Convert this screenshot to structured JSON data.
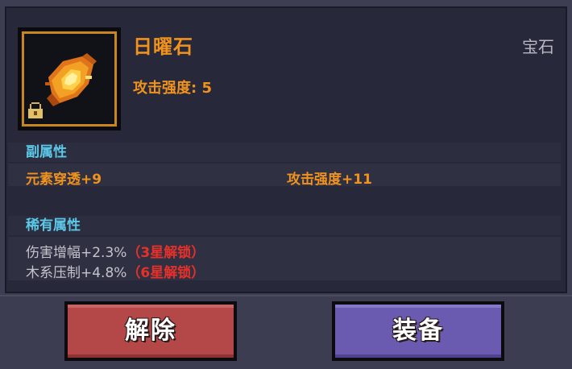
{
  "item": {
    "name": "日曜石",
    "type": "宝石",
    "main_stat": "攻击强度: 5",
    "icon": "sun-stone-gem-icon",
    "locked_icon": "lock-icon",
    "frame_color": "#c8871e"
  },
  "sub_attributes": {
    "header": "副属性",
    "stats": [
      "元素穿透+9",
      "攻击强度+11"
    ]
  },
  "rare_attributes": {
    "header": "稀有属性",
    "lines": [
      {
        "text": "伤害增幅+2.3%",
        "lock_text": "（3星解锁）"
      },
      {
        "text": "木系压制+4.8%",
        "lock_text": "（6星解锁）"
      }
    ]
  },
  "buttons": {
    "unequip_label": "解除",
    "equip_label": "装备"
  },
  "colors": {
    "accent_orange": "#f0921e",
    "header_cyan": "#5bc8e8",
    "locked_red": "#e8302a",
    "unequip_red": "#b44748",
    "equip_purple": "#6a5bb0"
  }
}
